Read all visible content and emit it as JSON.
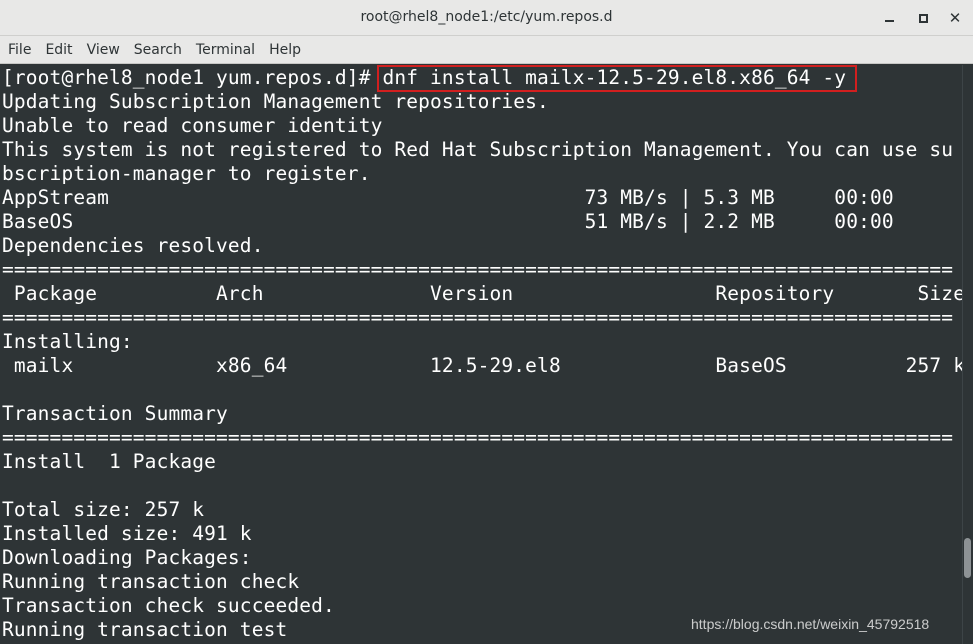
{
  "window": {
    "title": "root@rhel8_node1:/etc/yum.repos.d",
    "minimize_glyph": "minimize",
    "maximize_glyph": "maximize",
    "close_glyph": "✕"
  },
  "menu": {
    "items": [
      "File",
      "Edit",
      "View",
      "Search",
      "Terminal",
      "Help"
    ]
  },
  "terminal": {
    "lines": [
      "[root@rhel8_node1 yum.repos.d]# dnf install mailx-12.5-29.el8.x86_64 -y",
      "Updating Subscription Management repositories.",
      "Unable to read consumer identity",
      "This system is not registered to Red Hat Subscription Management. You can use su",
      "bscription-manager to register.",
      "AppStream                                        73 MB/s | 5.3 MB     00:00",
      "BaseOS                                           51 MB/s | 2.2 MB     00:00",
      "Dependencies resolved.",
      "================================================================================",
      " Package          Arch              Version                 Repository       Size",
      "================================================================================",
      "Installing:",
      " mailx            x86_64            12.5-29.el8             BaseOS          257 k",
      "",
      "Transaction Summary",
      "================================================================================",
      "Install  1 Package",
      "",
      "Total size: 257 k",
      "Installed size: 491 k",
      "Downloading Packages:",
      "Running transaction check",
      "Transaction check succeeded.",
      "Running transaction test"
    ]
  },
  "watermark": "https://blog.csdn.net/weixin_45792518",
  "colors": {
    "terminal_bg": "#2e3436",
    "terminal_fg": "#ffffff",
    "highlight": "#d21f1f",
    "chrome_bg": "#e8e8e7"
  }
}
